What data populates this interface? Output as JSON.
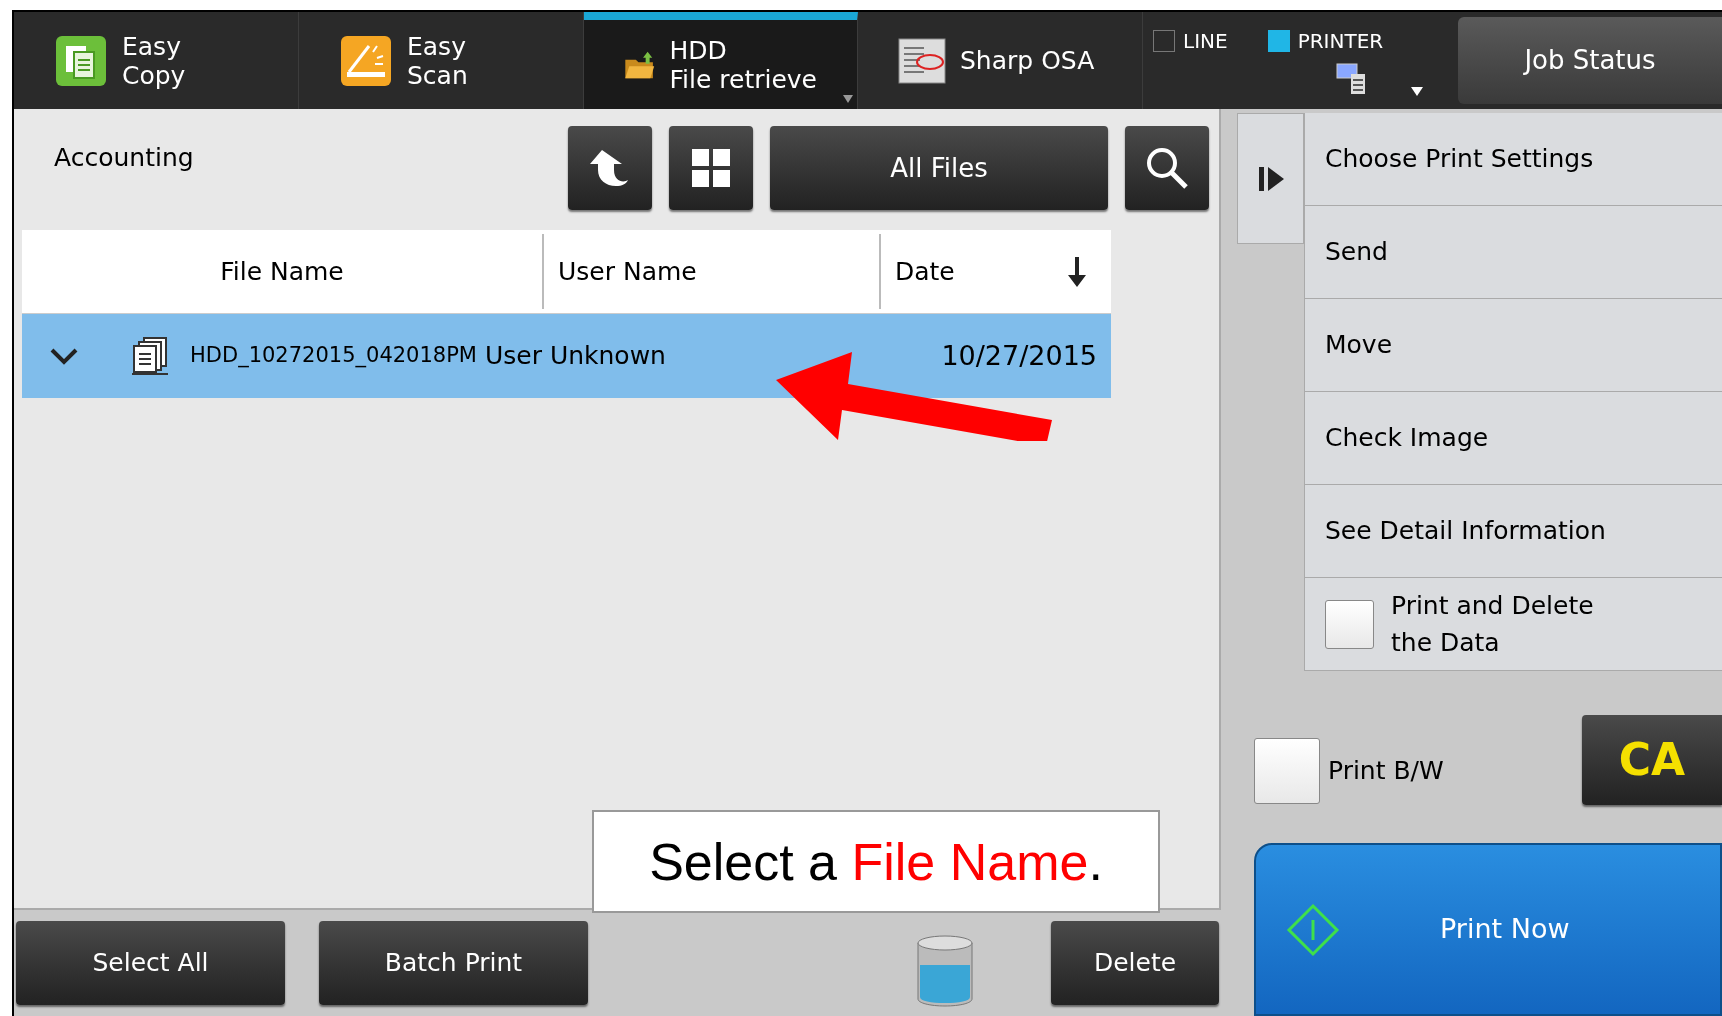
{
  "top_tabs": [
    {
      "kind": "copy",
      "lines": [
        "Easy",
        "Copy"
      ],
      "selected": false
    },
    {
      "kind": "scan",
      "lines": [
        "Easy",
        "Scan"
      ],
      "selected": false
    },
    {
      "kind": "hdd",
      "lines": [
        "HDD",
        "File retrieve"
      ],
      "selected": true
    },
    {
      "kind": "osa",
      "lines": [
        "Sharp OSA"
      ],
      "selected": false
    }
  ],
  "indicators": [
    {
      "label": "LINE",
      "on": false
    },
    {
      "label": "PRINTER",
      "on": true
    }
  ],
  "job_status": "Job Status",
  "folder": "Accounting",
  "filter": "All Files",
  "table": {
    "columns": [
      "File Name",
      "User Name",
      "Date"
    ],
    "rows": [
      {
        "file_name": "HDD_10272015_042018PM",
        "user_name": "User Unknown",
        "date": "10/27/2015",
        "selected": true
      }
    ]
  },
  "caption": [
    {
      "text": "Select a ",
      "color": "#000000"
    },
    {
      "text": "File Name",
      "color": "#ff0000"
    },
    {
      "text": ".",
      "color": "#000000"
    }
  ],
  "bottom_buttons": [
    "Select All",
    "Batch Print"
  ],
  "delete": "Delete",
  "menu": [
    {
      "kind": "action",
      "label": "Choose Print Settings"
    },
    {
      "kind": "action",
      "label": "Send"
    },
    {
      "kind": "action",
      "label": "Move"
    },
    {
      "kind": "action",
      "label": "Check Image"
    },
    {
      "kind": "action",
      "label": "See Detail Information"
    },
    {
      "kind": "check",
      "label": "Print and Delete the Data",
      "checked": false
    }
  ],
  "print_bw": {
    "label": "Print B/W",
    "checked": false
  },
  "ca": "CA",
  "print_now": "Print Now"
}
